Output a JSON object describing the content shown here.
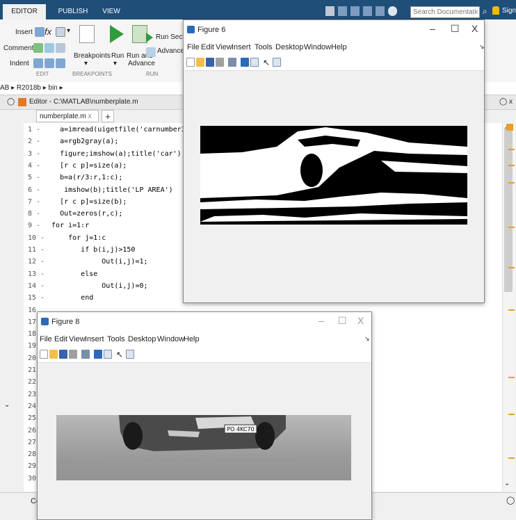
{
  "tabs": [
    "EDITOR",
    "PUBLISH",
    "VIEW"
  ],
  "ribbon": {
    "insert": "Insert",
    "comment": "Comment",
    "indent": "Indent",
    "breakpoints": "Breakpoints",
    "run": "Run",
    "run_and_advance_1": "Run and",
    "run_and_advance_2": "Advance",
    "run_section": "Run Section",
    "advance": "Advance",
    "sec_edit": "EDIT",
    "sec_breakpoints": "BREAKPOINTS",
    "sec_run": "RUN"
  },
  "search": {
    "placeholder": "Search Documentation"
  },
  "sign_in": "Sign",
  "breadcrumb": "AB ▸ R2018b ▸ bin ▸",
  "editor": {
    "header": "Editor - C:\\MATLAB\\numberplate.m",
    "file_tab": "numberplate.m",
    "plus": "+"
  },
  "code_lines": [
    {
      "n": "1 -",
      "t": "    a=imread(uigetfile('carnumber3.jpg'));"
    },
    {
      "n": "2 -",
      "t": "    a=rgb2gray(a);"
    },
    {
      "n": "3 -",
      "t": "    figure;imshow(a);title('car');"
    },
    {
      "n": "4 -",
      "t": "    [r c p]=size(a);"
    },
    {
      "n": "5 -",
      "t": "    b=a(r/3:r,1:c);"
    },
    {
      "n": "6 -",
      "t": "     imshow(b);title('LP AREA')"
    },
    {
      "n": "7 -",
      "t": "    [r c p]=size(b);"
    },
    {
      "n": "8 -",
      "t": "    Out=zeros(r,c);"
    },
    {
      "n": "9 -",
      "t": "  for i=1:r"
    },
    {
      "n": "10 -",
      "t": "      for j=1:c"
    },
    {
      "n": "11 -",
      "t": "         if b(i,j)>150"
    },
    {
      "n": "12 -",
      "t": "              Out(i,j)=1;"
    },
    {
      "n": "13 -",
      "t": "         else"
    },
    {
      "n": "14 -",
      "t": "              Out(i,j)=0;"
    },
    {
      "n": "15 -",
      "t": "         end"
    },
    {
      "n": "16",
      "t": ""
    },
    {
      "n": "17",
      "t": ""
    },
    {
      "n": "18",
      "t": ""
    },
    {
      "n": "19",
      "t": ""
    },
    {
      "n": "20",
      "t": ""
    },
    {
      "n": "21",
      "t": ""
    },
    {
      "n": "22",
      "t": ""
    },
    {
      "n": "23",
      "t": ""
    },
    {
      "n": "24",
      "t": ""
    },
    {
      "n": "25",
      "t": ""
    },
    {
      "n": "26",
      "t": ""
    },
    {
      "n": "27",
      "t": ""
    },
    {
      "n": "28",
      "t": ""
    },
    {
      "n": "29",
      "t": ""
    },
    {
      "n": "30",
      "t": ""
    }
  ],
  "status_text": "Co",
  "figure6": {
    "title": "Figure 6",
    "menu": [
      "File",
      "Edit",
      "View",
      "Insert",
      "Tools",
      "Desktop",
      "Window",
      "Help"
    ]
  },
  "figure8": {
    "title": "Figure 8",
    "menu": [
      "File",
      "Edit",
      "View",
      "Insert",
      "Tools",
      "Desktop",
      "Window",
      "Help"
    ],
    "plate_text": "PO 4KC70"
  },
  "window_controls": {
    "minimize": "–",
    "maximize": "☐",
    "close": "X"
  }
}
